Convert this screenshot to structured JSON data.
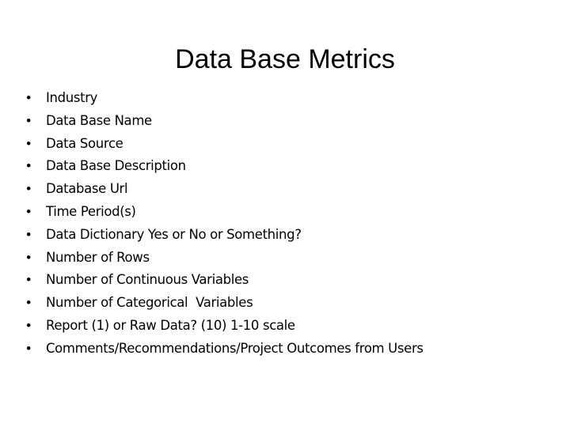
{
  "slide": {
    "title": "Data Base Metrics",
    "bullet_glyph": "•",
    "items": [
      {
        "label": "Industry"
      },
      {
        "label": "Data Base Name"
      },
      {
        "label": "Data Source"
      },
      {
        "label": "Data Base Description"
      },
      {
        "label": "Database Url"
      },
      {
        "label": "Time Period(s)"
      },
      {
        "label": "Data Dictionary Yes or No or Something?"
      },
      {
        "label": "Number of Rows"
      },
      {
        "label": "Number of Continuous Variables"
      },
      {
        "label": "Number of Categorical  Variables"
      },
      {
        "label": "Report (1) or Raw Data? (10) 1-10 scale"
      },
      {
        "label": "Comments/Recommendations/Project Outcomes from Users"
      }
    ]
  }
}
